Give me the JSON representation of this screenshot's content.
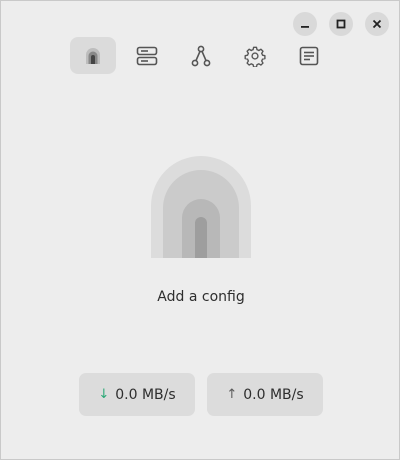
{
  "window": {
    "controls": [
      "minimize-icon",
      "maximize-icon",
      "close-icon"
    ]
  },
  "tabs": [
    {
      "icon": "home-arch-icon",
      "active": true
    },
    {
      "icon": "servers-icon",
      "active": false
    },
    {
      "icon": "routing-icon",
      "active": false
    },
    {
      "icon": "gear-icon",
      "active": false
    },
    {
      "icon": "logs-icon",
      "active": false
    }
  ],
  "main": {
    "empty_state": "Add a config"
  },
  "speeds": {
    "download_arrow": "↓",
    "download": "0.0 MB/s",
    "upload_arrow": "↑",
    "upload": "0.0 MB/s"
  },
  "colors": {
    "background": "#ededed",
    "download_arrow": "#2aa876"
  }
}
